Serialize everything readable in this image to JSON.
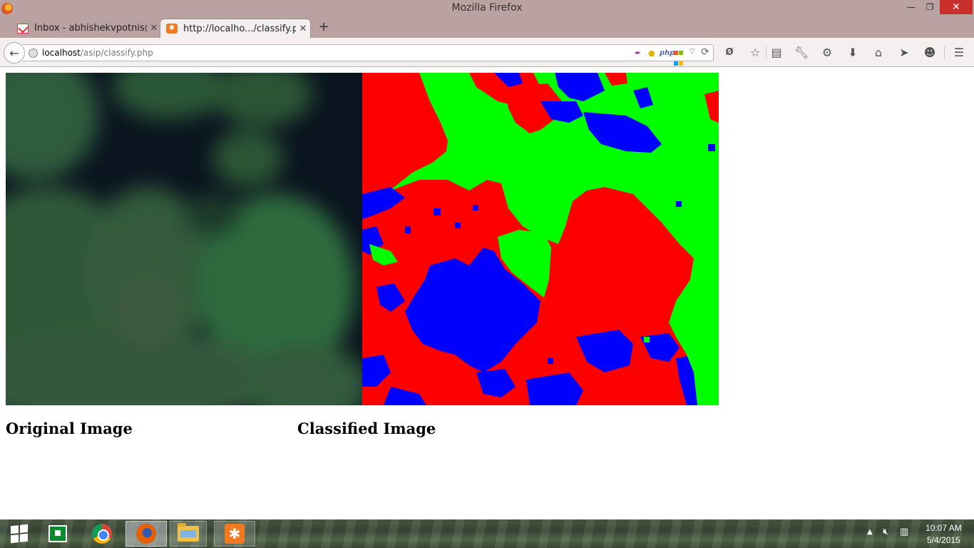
{
  "window": {
    "title": "Mozilla Firefox",
    "minimize_glyph": "—",
    "maximize_glyph": "❐",
    "close_glyph": "✕"
  },
  "tabs": [
    {
      "title": "Inbox - abhishekvpotnis@...",
      "icon": "gmail-icon",
      "close": "✕"
    },
    {
      "title": "http://localho.../classify.php",
      "icon": "xampp-icon",
      "close": "✕"
    }
  ],
  "new_tab_glyph": "+",
  "nav": {
    "back_glyph": "←",
    "url_host": "localhost",
    "url_path": "/asip/classify.php",
    "reload_glyph": "⟳",
    "dropdown_glyph": "▽",
    "ext_php_label": "php",
    "toolbar_icons": [
      "readability-icon",
      "bookmark-star-icon",
      "reading-list-icon",
      "wrench-icon",
      "gear-icon",
      "download-icon",
      "home-icon",
      "send-icon",
      "chat-icon",
      "menu-icon"
    ]
  },
  "page": {
    "caption_original": "Original Image",
    "caption_classified": "Classified Image"
  },
  "taskbar": {
    "apps": [
      "start-button",
      "store-app",
      "chrome-app",
      "firefox-app",
      "file-explorer-app",
      "xampp-app"
    ],
    "clock_time": "10:07 AM",
    "clock_date": "5/4/2015",
    "tray_up_glyph": "▲"
  },
  "colors": {
    "titlebar": "#bba2a2",
    "class_red": "#ff0000",
    "class_green": "#00ff00",
    "class_blue": "#0000ff",
    "close_button": "#c9302c"
  }
}
